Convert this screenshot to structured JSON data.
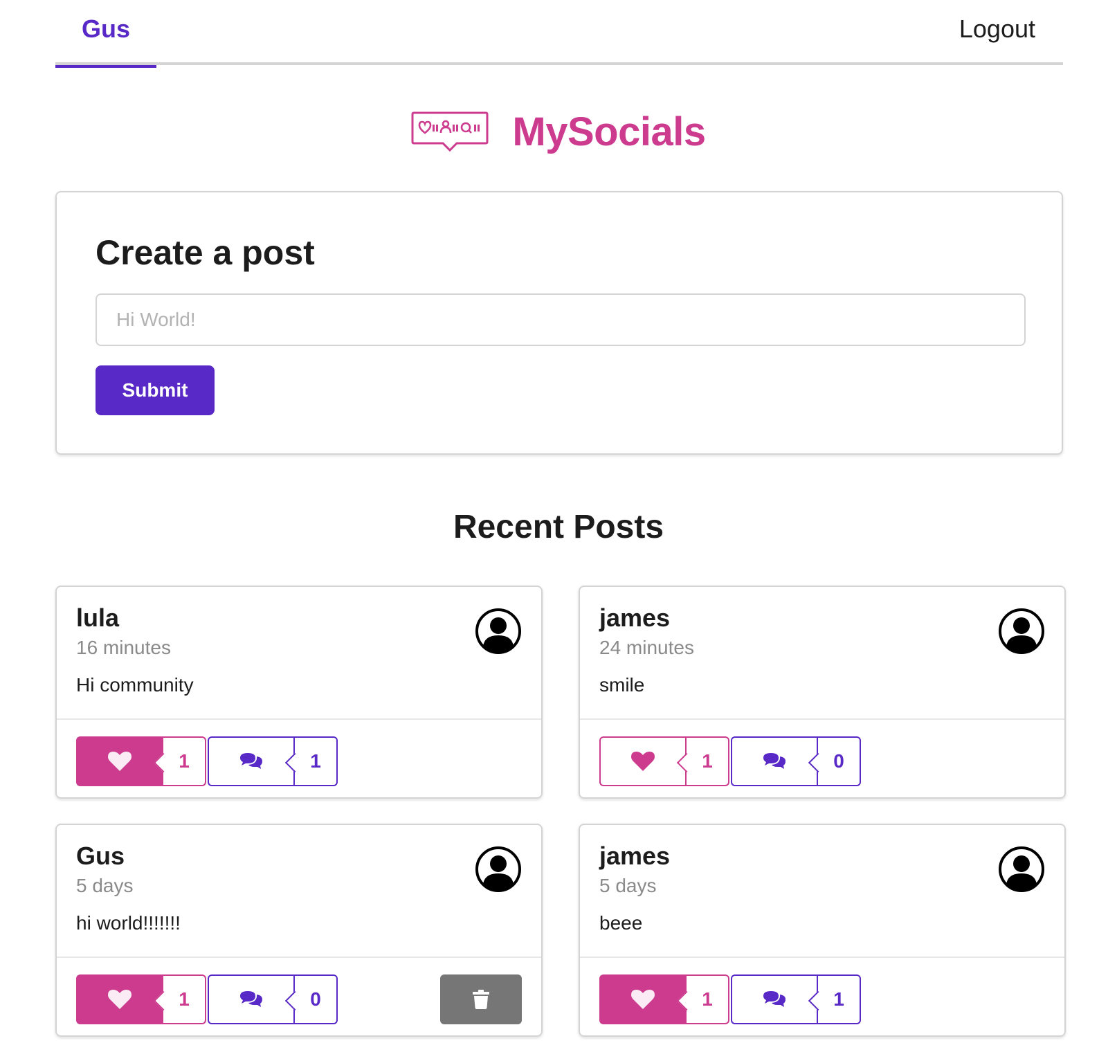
{
  "nav": {
    "user_label": "Gus",
    "logout_label": "Logout"
  },
  "brand": {
    "name": "MySocials",
    "logo_icon": "chat-bubble-social-icon"
  },
  "create_post": {
    "title": "Create a post",
    "input_placeholder": "Hi World!",
    "input_value": "",
    "submit_label": "Submit"
  },
  "recent": {
    "title": "Recent Posts",
    "posts": [
      {
        "author": "lula",
        "time": "16 minutes",
        "body": "Hi community",
        "likes": "1",
        "comments": "1",
        "liked": true,
        "can_delete": false
      },
      {
        "author": "james",
        "time": "24 minutes",
        "body": "smile",
        "likes": "1",
        "comments": "0",
        "liked": false,
        "can_delete": false
      },
      {
        "author": "Gus",
        "time": "5 days",
        "body": "hi world!!!!!!!",
        "likes": "1",
        "comments": "0",
        "liked": true,
        "can_delete": true
      },
      {
        "author": "james",
        "time": "5 days",
        "body": "beee",
        "likes": "1",
        "comments": "1",
        "liked": true,
        "can_delete": false
      }
    ]
  },
  "colors": {
    "accent_purple": "#5829c7",
    "accent_pink": "#cc3b8e",
    "delete_gray": "#767676"
  }
}
